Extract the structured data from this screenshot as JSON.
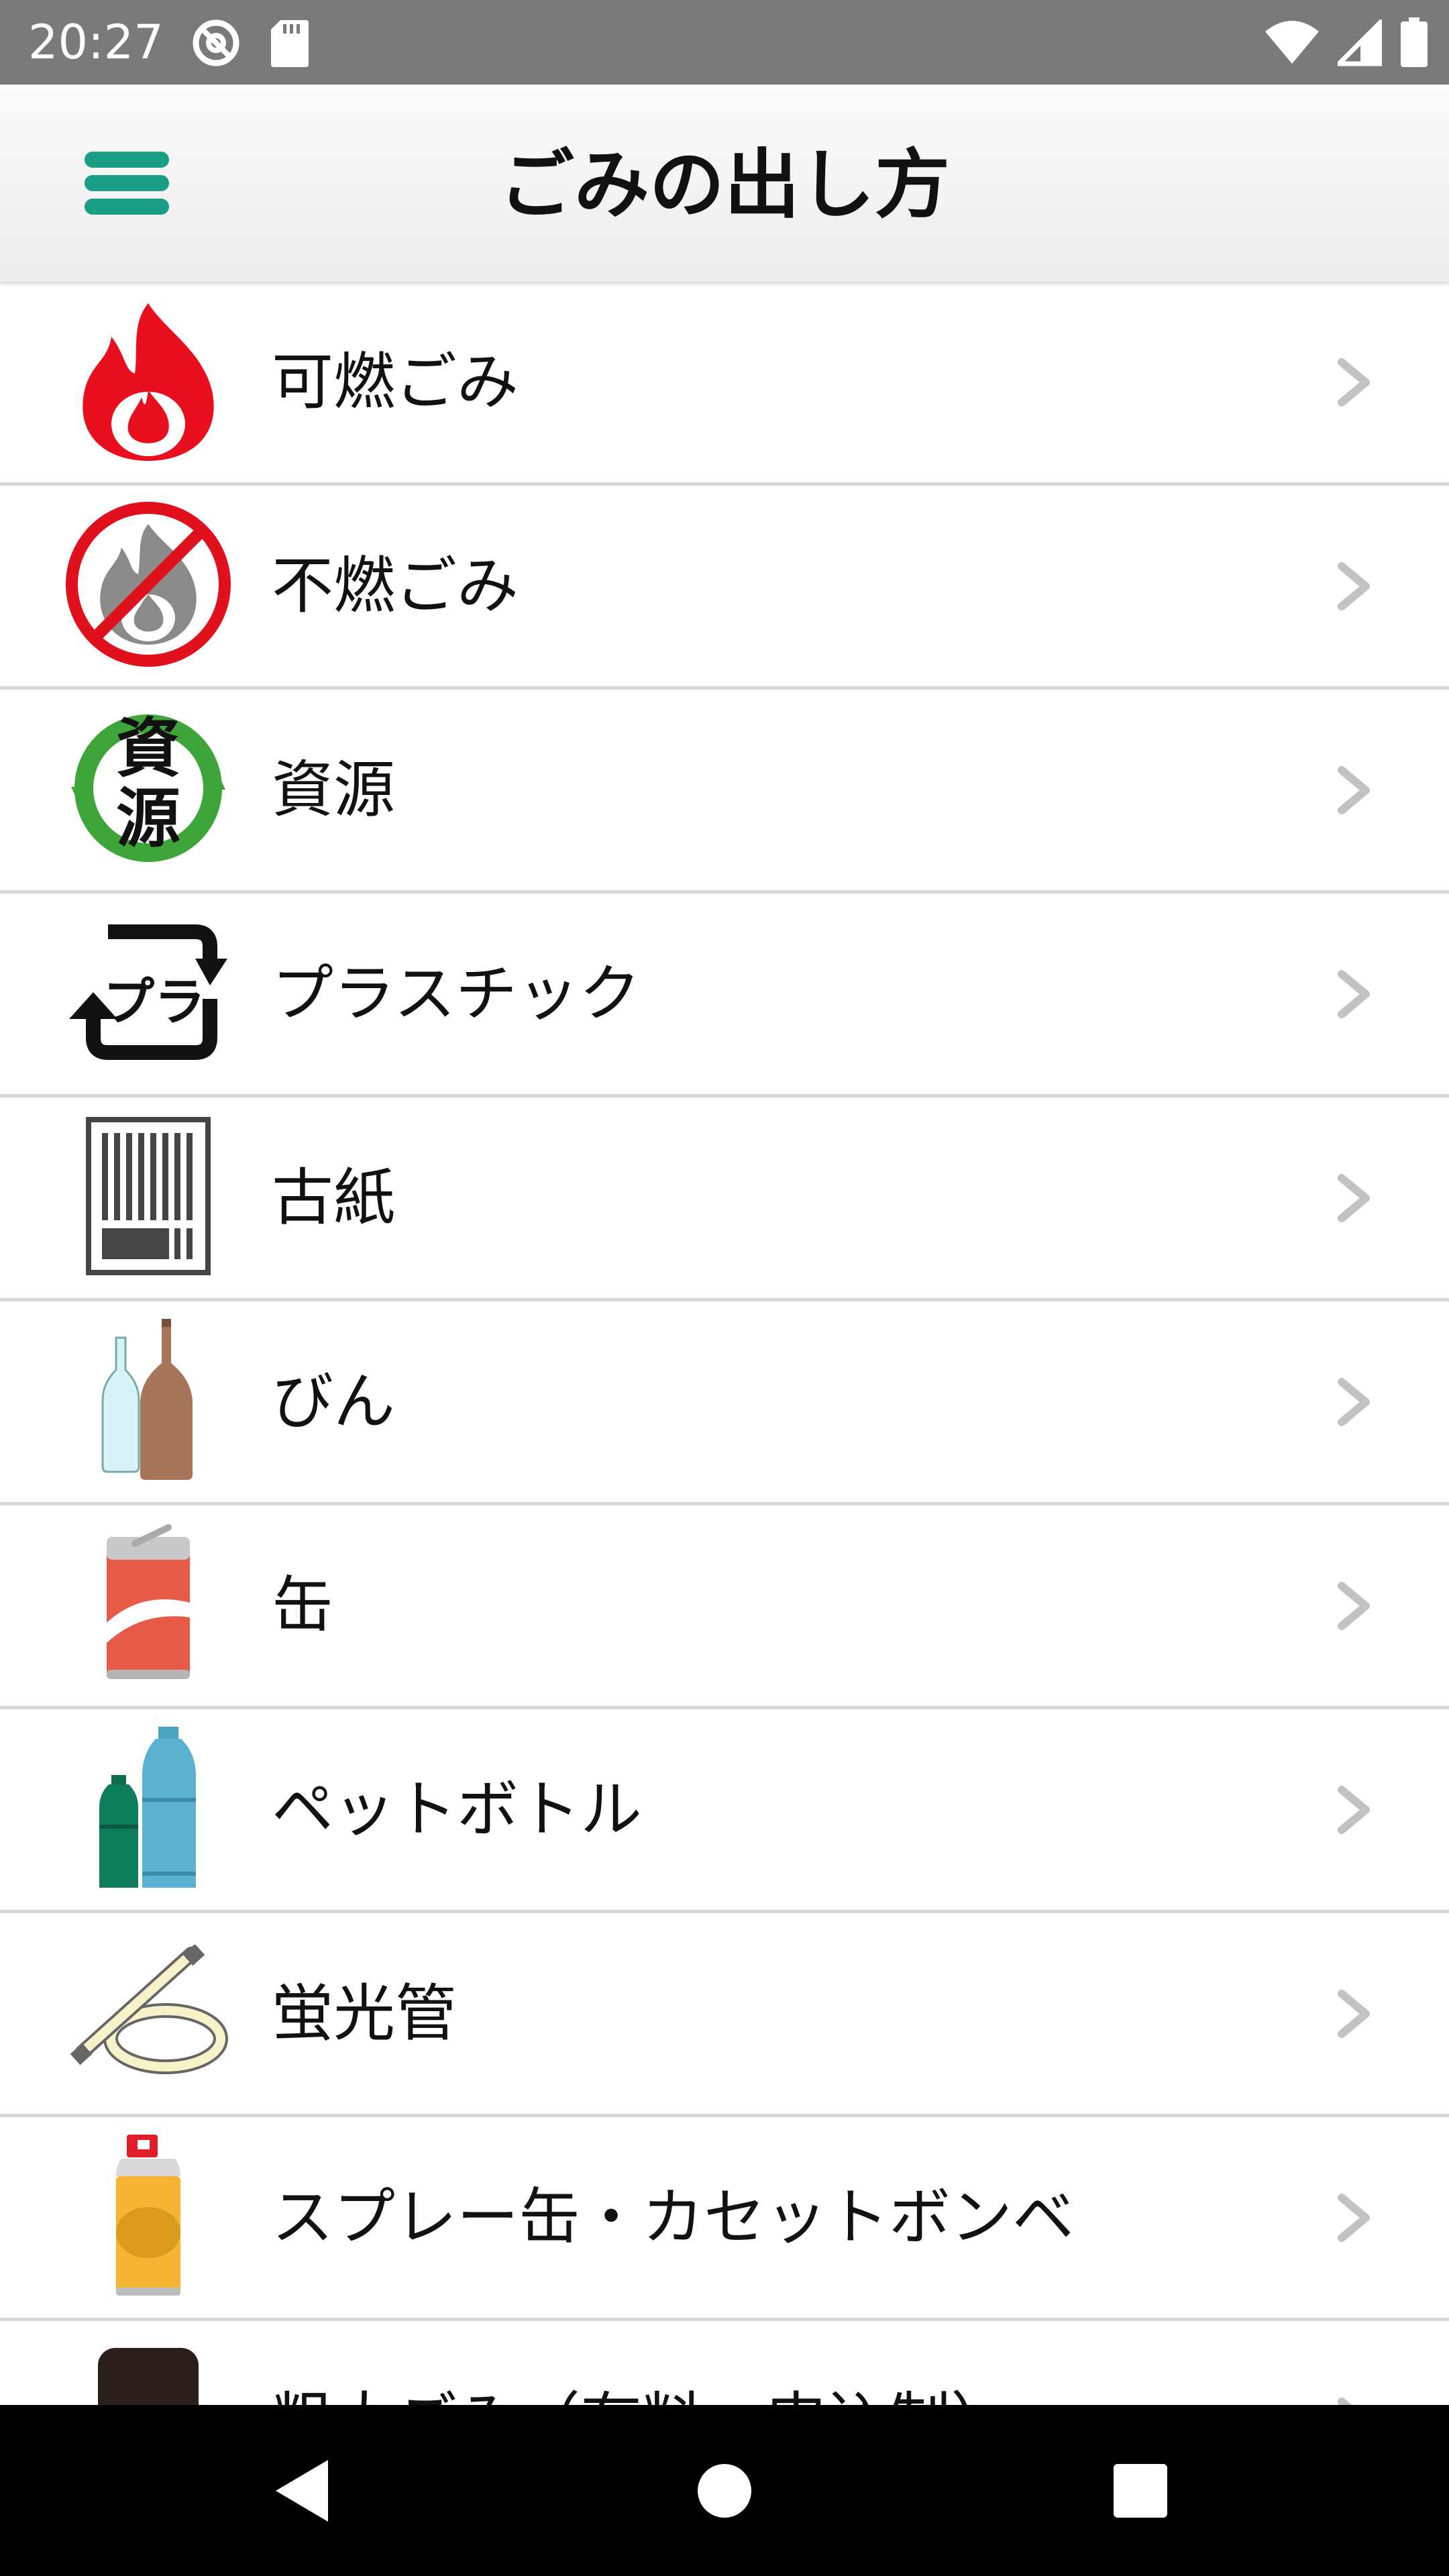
{
  "status_bar": {
    "time": "20:27",
    "left_icons": [
      "at-sign-icon",
      "sd-card-icon"
    ],
    "right_icons": [
      "wifi-icon",
      "signal-icon",
      "battery-icon"
    ]
  },
  "header": {
    "title": "ごみの出し方",
    "menu_icon": "hamburger-menu-icon",
    "accent_color": "#1a9f86"
  },
  "categories": [
    {
      "label": "可燃ごみ",
      "icon": "flame-icon"
    },
    {
      "label": "不燃ごみ",
      "icon": "no-flame-icon"
    },
    {
      "label": "資源",
      "icon": "recycle-resource-icon",
      "icon_text": [
        "資",
        "源"
      ]
    },
    {
      "label": "プラスチック",
      "icon": "plastic-recycle-icon",
      "icon_text": "プラ"
    },
    {
      "label": "古紙",
      "icon": "old-paper-icon"
    },
    {
      "label": "びん",
      "icon": "bottles-icon"
    },
    {
      "label": "缶",
      "icon": "can-icon"
    },
    {
      "label": "ペットボトル",
      "icon": "pet-bottle-icon"
    },
    {
      "label": "蛍光管",
      "icon": "fluorescent-tube-icon"
    },
    {
      "label": "スプレー缶・カセットボンベ",
      "icon": "spray-can-icon"
    },
    {
      "label": "粗大ごみ（有料・申込制）",
      "icon": "chair-icon"
    }
  ],
  "nav_bar": {
    "buttons": [
      "back-icon",
      "home-icon",
      "recents-icon"
    ]
  }
}
